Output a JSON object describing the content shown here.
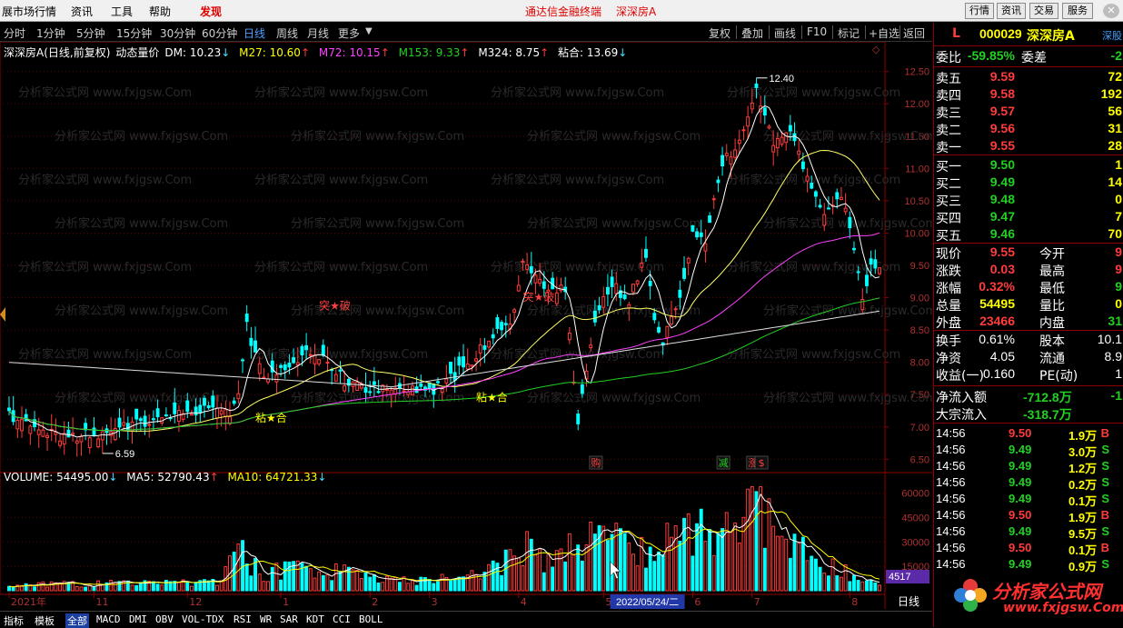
{
  "menu": {
    "items": [
      "展市场行情",
      "资讯",
      "工具",
      "帮助",
      "发现"
    ],
    "banner": "通达信金融终端",
    "banner_stock": "深深房A",
    "right_buttons": [
      "行情",
      "资讯",
      "交易",
      "服务"
    ]
  },
  "periods": [
    "分时",
    "1分钟",
    "5分钟",
    "15分钟",
    "30分钟",
    "60分钟",
    "日线",
    "周线",
    "月线",
    "更多"
  ],
  "active_period": "日线",
  "tools": [
    "复权",
    "叠加",
    "画线",
    "F10",
    "标记",
    "+自选",
    "返回"
  ],
  "indicator_line": {
    "name": "深深房A(日线,前复权)",
    "title": "动态量价",
    "dm": "DM: 10.23",
    "m27": "M27: 10.60",
    "m72": "M72: 10.15",
    "m153": "M153: 9.33",
    "m324": "M324: 8.75",
    "nianhe": "粘合: 13.69"
  },
  "volume_line": {
    "volume": "VOLUME: 54495.00",
    "ma5": "MA5: 52790.43",
    "ma10": "MA10: 64721.33"
  },
  "chart_data": {
    "type": "candlestick",
    "price_axis": [
      "12.50",
      "12.00",
      "11.50",
      "11.00",
      "10.50",
      "10.00",
      "9.50",
      "9.00",
      "8.50",
      "8.00",
      "7.50",
      "7.00",
      "6.50"
    ],
    "volume_axis": [
      "60000",
      "45000",
      "30000",
      "15000"
    ],
    "ylim_price": [
      6.35,
      12.65
    ],
    "ylim_volume": [
      0,
      66000
    ],
    "month_labels": [
      "2021年",
      "11",
      "12",
      "1",
      "2",
      "3",
      "4",
      "5",
      "6",
      "7",
      "8"
    ],
    "month_label_positions": [
      0,
      20,
      42,
      64,
      85,
      99,
      120,
      140,
      161,
      175,
      198
    ],
    "high_label": "12.40",
    "low_label": "6.59",
    "annotations": [
      "突★破",
      "粘★合",
      "粘★合",
      "突★破"
    ],
    "signal_markers": [
      {
        "text": "购",
        "color": "#ff4040",
        "day": 138
      },
      {
        "text": "减",
        "color": "#22d022",
        "day": 168
      },
      {
        "text": "涨",
        "color": "#ff4040",
        "day": 175
      },
      {
        "text": "$",
        "color": "#ff4040",
        "day": 177
      }
    ],
    "date_cursor": "2022/05/24/二",
    "volume_value_tag": "4517",
    "period_label": "日线",
    "days": 206,
    "close_segments": [
      [
        0,
        7.2
      ],
      [
        12,
        6.85
      ],
      [
        22,
        6.9
      ],
      [
        34,
        7.1
      ],
      [
        46,
        7.25
      ],
      [
        52,
        7.2
      ],
      [
        54,
        7.6
      ],
      [
        56,
        8.55
      ],
      [
        60,
        7.7
      ],
      [
        66,
        7.95
      ],
      [
        70,
        8.2
      ],
      [
        74,
        8.1
      ],
      [
        80,
        7.62
      ],
      [
        90,
        7.58
      ],
      [
        100,
        7.55
      ],
      [
        104,
        7.75
      ],
      [
        110,
        8.1
      ],
      [
        114,
        8.45
      ],
      [
        118,
        8.6
      ],
      [
        121,
        9.5
      ],
      [
        126,
        9.2
      ],
      [
        131,
        9.1
      ],
      [
        134,
        7.1
      ],
      [
        138,
        8.7
      ],
      [
        142,
        9.2
      ],
      [
        146,
        8.95
      ],
      [
        150,
        9.7
      ],
      [
        152,
        8.6
      ],
      [
        154,
        8.35
      ],
      [
        158,
        9.0
      ],
      [
        161,
        10.0
      ],
      [
        164,
        9.9
      ],
      [
        168,
        11.1
      ],
      [
        172,
        11.4
      ],
      [
        176,
        12.2
      ],
      [
        180,
        11.4
      ],
      [
        184,
        11.5
      ],
      [
        188,
        10.9
      ],
      [
        192,
        10.2
      ],
      [
        196,
        10.6
      ],
      [
        199,
        9.8
      ],
      [
        201,
        9.05
      ],
      [
        203,
        9.45
      ],
      [
        205,
        9.55
      ]
    ],
    "volume_profile": [
      [
        0,
        4000
      ],
      [
        50,
        5000
      ],
      [
        54,
        26000
      ],
      [
        60,
        12000
      ],
      [
        70,
        15000
      ],
      [
        90,
        6000
      ],
      [
        110,
        9000
      ],
      [
        120,
        27000
      ],
      [
        128,
        22000
      ],
      [
        138,
        30000
      ],
      [
        146,
        32000
      ],
      [
        152,
        28000
      ],
      [
        160,
        36000
      ],
      [
        170,
        40000
      ],
      [
        176,
        58000
      ],
      [
        182,
        30000
      ],
      [
        192,
        16000
      ],
      [
        205,
        7000
      ]
    ]
  },
  "panel": {
    "code": "000029",
    "name": "深深房A",
    "exchange": "深股",
    "weibi_label": "委比",
    "weibi": "-59.85%",
    "weicha_label": "委差",
    "weicha": "-2",
    "asks": [
      {
        "label": "卖五",
        "price": "9.59",
        "vol": "72"
      },
      {
        "label": "卖四",
        "price": "9.58",
        "vol": "192"
      },
      {
        "label": "卖三",
        "price": "9.57",
        "vol": "56"
      },
      {
        "label": "卖二",
        "price": "9.56",
        "vol": "31"
      },
      {
        "label": "卖一",
        "price": "9.55",
        "vol": "28"
      }
    ],
    "bids": [
      {
        "label": "买一",
        "price": "9.50",
        "vol": "1"
      },
      {
        "label": "买二",
        "price": "9.49",
        "vol": "14"
      },
      {
        "label": "买三",
        "price": "9.48",
        "vol": "0"
      },
      {
        "label": "买四",
        "price": "9.47",
        "vol": "7"
      },
      {
        "label": "买五",
        "price": "9.46",
        "vol": "70"
      }
    ],
    "quote": [
      {
        "l": "现价",
        "v": "9.55",
        "vc": "red",
        "l2": "今开",
        "v2": "9",
        "v2c": "red"
      },
      {
        "l": "涨跌",
        "v": "0.03",
        "vc": "red",
        "l2": "最高",
        "v2": "9",
        "v2c": "red"
      },
      {
        "l": "涨幅",
        "v": "0.32%",
        "vc": "red",
        "l2": "最低",
        "v2": "9",
        "v2c": "green"
      },
      {
        "l": "总量",
        "v": "54495",
        "vc": "yellow",
        "l2": "量比",
        "v2": "0",
        "v2c": "yellow"
      },
      {
        "l": "外盘",
        "v": "23466",
        "vc": "red",
        "l2": "内盘",
        "v2": "31",
        "v2c": "green"
      }
    ],
    "info": [
      {
        "l": "换手",
        "v": "0.61%",
        "l2": "股本",
        "v2": "10.1"
      },
      {
        "l": "净资",
        "v": "4.05",
        "l2": "流通",
        "v2": "8.9"
      },
      {
        "l": "收益(一)",
        "v": "0.160",
        "l2": "PE(动)",
        "v2": "1"
      }
    ],
    "flows": [
      {
        "l": "净流入额",
        "v": "-712.8万",
        "v2": "-1"
      },
      {
        "l": "大宗流入",
        "v": "-318.7万",
        "v2": ""
      }
    ],
    "ticks": [
      {
        "t": "14:56",
        "p": "9.50",
        "v": "1.9万",
        "bs": "B"
      },
      {
        "t": "14:56",
        "p": "9.49",
        "v": "3.0万",
        "bs": "S"
      },
      {
        "t": "14:56",
        "p": "9.49",
        "v": "1.2万",
        "bs": "S"
      },
      {
        "t": "14:56",
        "p": "9.49",
        "v": "0.2万",
        "bs": "S"
      },
      {
        "t": "14:56",
        "p": "9.49",
        "v": "0.1万",
        "bs": "S"
      },
      {
        "t": "14:56",
        "p": "9.50",
        "v": "1.9万",
        "bs": "B"
      },
      {
        "t": "14:56",
        "p": "9.49",
        "v": "9.5万",
        "bs": "S"
      },
      {
        "t": "14:56",
        "p": "9.50",
        "v": "0.1万",
        "bs": "B"
      },
      {
        "t": "14:56",
        "p": "9.49",
        "v": "0.9万",
        "bs": "S"
      }
    ]
  },
  "tabs": [
    "指标",
    "模板",
    "全部",
    "MACD",
    "DMI",
    "OBV",
    "VOL-TDX",
    "RSI",
    "WR",
    "SAR",
    "KDT",
    "CCI",
    "BOLL"
  ],
  "active_tab": "全部",
  "watermark": "分析家公式网 www.fxjgsw.Com",
  "logo": {
    "name": "分析家公式网",
    "url": "www.fxjgsw.Com"
  },
  "colors": {
    "up": "#ff3c3c",
    "down": "#00ffff",
    "ma27": "#ffff66",
    "ma72": "#ff40ff",
    "ma153": "#22d022",
    "ma324": "#dddddd"
  }
}
